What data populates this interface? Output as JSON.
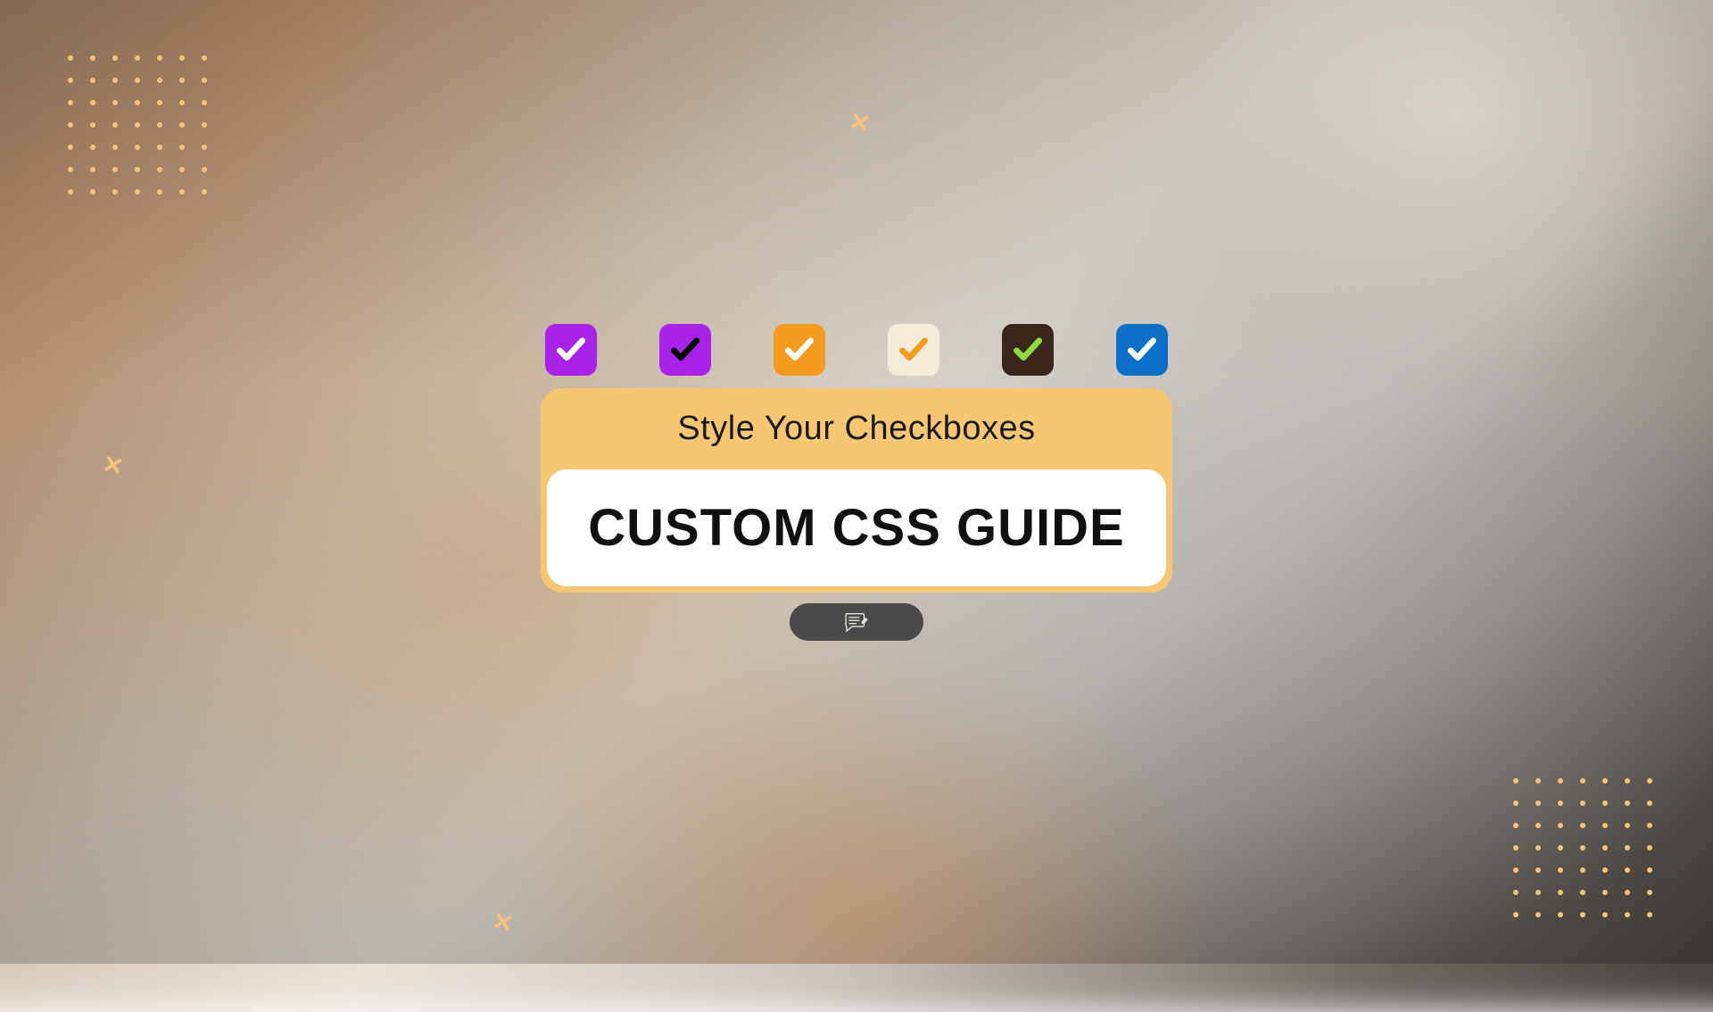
{
  "subtitle": "Style Your Checkboxes",
  "main_title": "CUSTOM CSS GUIDE",
  "checkboxes": [
    {
      "name": "purple-white",
      "bg": "#a922e8",
      "check": "#ffffff"
    },
    {
      "name": "purple-black",
      "bg": "#a922e8",
      "check": "#000000"
    },
    {
      "name": "orange-white",
      "bg": "#f29b1d",
      "check": "#ffffff"
    },
    {
      "name": "cream-orange",
      "bg": "#f4ecd9",
      "check": "#f29b1d"
    },
    {
      "name": "brown-green",
      "bg": "#3b261c",
      "check": "#8ddc3f"
    },
    {
      "name": "blue-white",
      "bg": "#0b6fc7",
      "check": "#ffffff"
    }
  ],
  "decor": {
    "dot_color": "#f3c37a",
    "x_glyph": "✕"
  }
}
